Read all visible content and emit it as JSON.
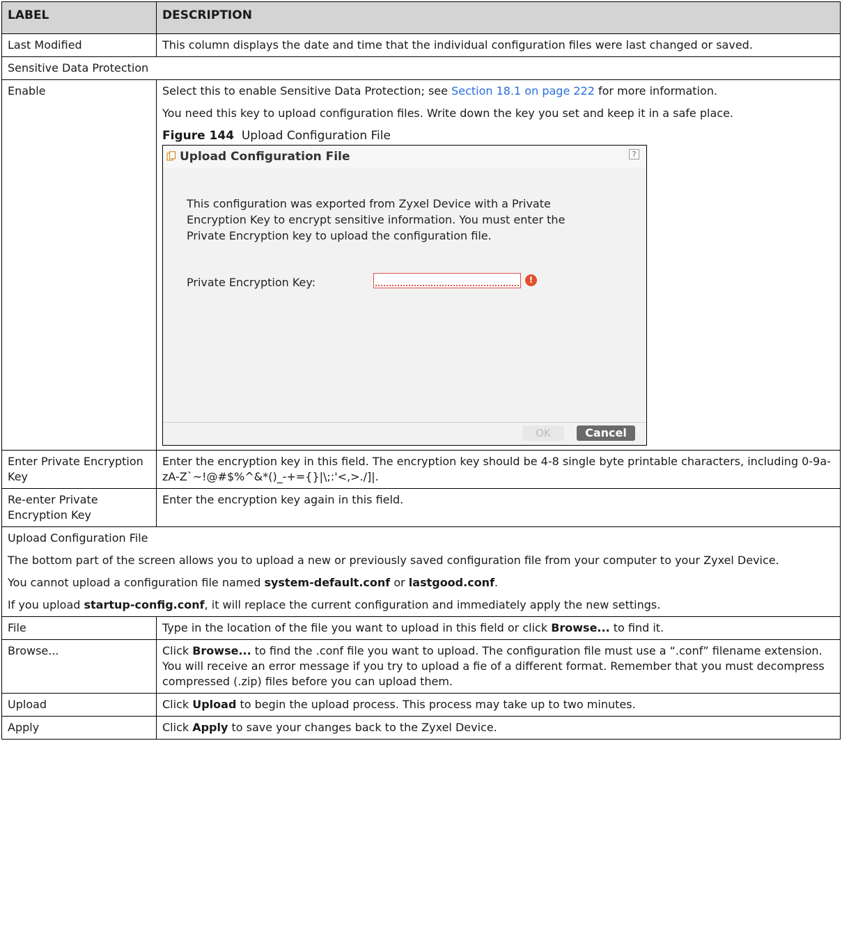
{
  "header": {
    "label": "LABEL",
    "description": "DESCRIPTION"
  },
  "last_modified": {
    "label": "Last Modified",
    "desc": "This column displays the date and time that the individual configuration files were last changed or saved."
  },
  "sensitive_section": "Sensitive Data Protection",
  "enable": {
    "label": "Enable",
    "p1_pre": "Select this to enable Sensitive Data Protection; see ",
    "p1_link": "Section 18.1 on page 222",
    "p1_post": " for more information.",
    "p2": "You need this key to upload configuration files. Write down the key you set and keep it in a safe place."
  },
  "figure": {
    "number": "Figure 144",
    "caption": "Upload Configuration File",
    "dialog": {
      "title": "Upload Configuration File",
      "help": "?",
      "message": "This configuration was exported from Zyxel Device with a Private Encryption Key to encrypt sensitive information. You must enter the Private Encryption key to upload the configuration file.",
      "key_label": "Private Encryption Key:",
      "key_value": "",
      "error_glyph": "!",
      "ok": "OK",
      "cancel": "Cancel"
    }
  },
  "enter_key": {
    "label": "Enter Private Encryption Key",
    "desc": "Enter the encryption key in this field. The encryption key should be 4-8 single byte printable characters, including 0-9a-zA-Z`~!@#$%^&*()_-+={}|\\;:'<,>./]|."
  },
  "reenter_key": {
    "label": "Re-enter Private Encryption Key",
    "desc": "Enter the encryption key again in this field."
  },
  "upload_section": {
    "title": "Upload Configuration File",
    "p1": "The bottom part of the screen allows you to upload a new or previously saved configuration file from your computer to your Zyxel Device.",
    "p2_pre": "You cannot upload a configuration file named ",
    "p2_b1": "system-default.conf",
    "p2_mid": " or ",
    "p2_b2": "lastgood.conf",
    "p2_post": ".",
    "p3_pre": "If you upload ",
    "p3_b": "startup-config.conf",
    "p3_post": ", it will replace the current configuration and immediately apply the new settings."
  },
  "file": {
    "label": "File",
    "pre": "Type in the location of the file you want to upload in this field or click ",
    "b": "Browse...",
    "post": " to find it."
  },
  "browse": {
    "label": "Browse...",
    "pre": "Click ",
    "b": "Browse...",
    "post": " to find the .conf file you want to upload. The configuration file must use a “.conf” filename extension. You will receive an error message if you try to upload a fie of a different format. Remember that you must decompress compressed (.zip) files before you can upload them."
  },
  "upload": {
    "label": "Upload",
    "pre": "Click ",
    "b": "Upload",
    "post": " to begin the upload process. This process may take up to two minutes."
  },
  "apply": {
    "label": "Apply",
    "pre": "Click ",
    "b": "Apply",
    "post": " to save your changes back to the Zyxel Device."
  }
}
